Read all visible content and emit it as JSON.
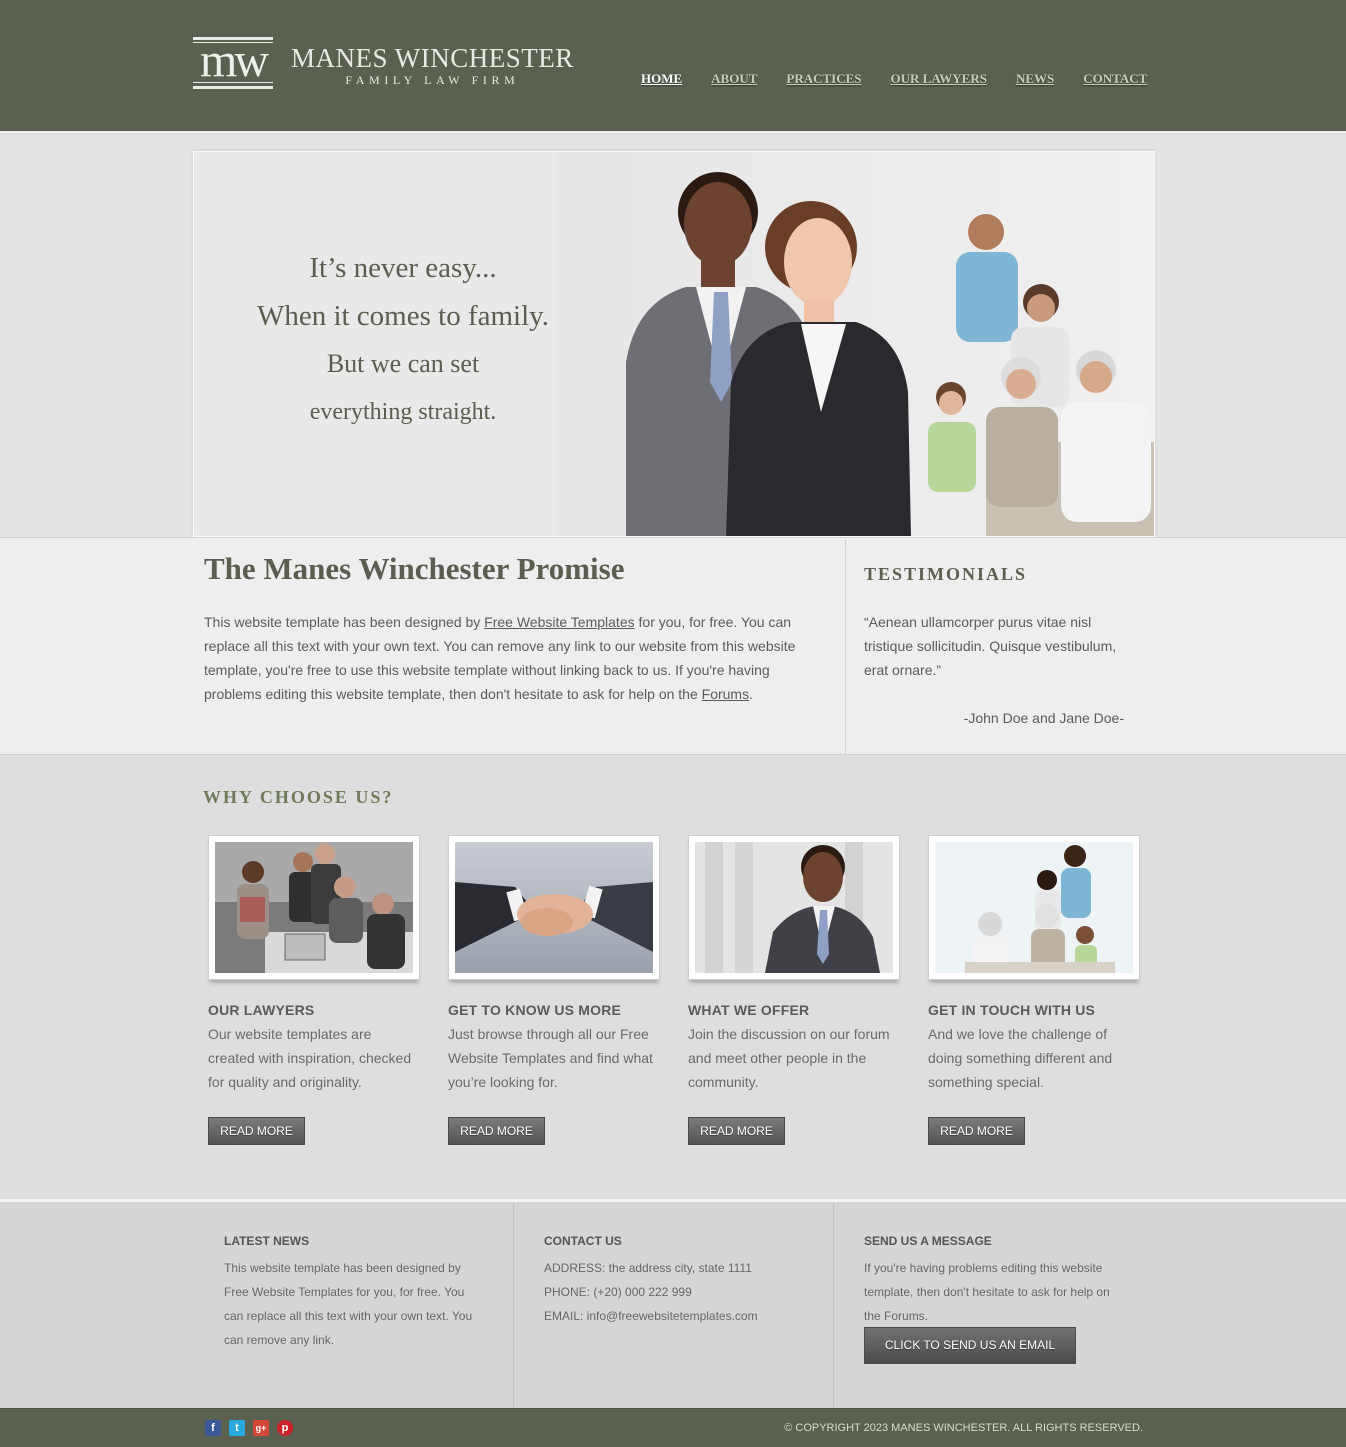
{
  "brand": {
    "logo_mark": "mw",
    "title": "MANES WINCHESTER",
    "subtitle": "FAMILY LAW FIRM"
  },
  "nav": {
    "home": "HOME",
    "about": "ABOUT",
    "practices": "PRACTICES",
    "lawyers": "OUR LAWYERS",
    "news": "NEWS",
    "contact": "CONTACT"
  },
  "hero": {
    "line1": "It’s never easy...",
    "line2": "When it comes to family.",
    "line3": "But we can set",
    "line4": "everything straight."
  },
  "promise": {
    "title": "The Manes Winchester Promise",
    "body_1": "This website template has been designed by ",
    "link_1": "Free Website Templates",
    "body_2": " for you, for free. You can replace all this text with your own text. You can remove any link to our website from this website template, you're free to use this website template without linking back to us. If you're having problems editing this website template, then don't hesitate to ask for help on the ",
    "link_2": "Forums",
    "body_3": "."
  },
  "testimonials": {
    "title": "TESTIMONIALS",
    "quote": "“Aenean ullamcorper purus vitae nisl tristique sollicitudin. Quisque vestibulum, erat ornare.”",
    "author": "-John Doe and Jane Doe-"
  },
  "why": {
    "title": "WHY CHOOSE US?",
    "cards": [
      {
        "heading": "OUR LAWYERS",
        "text": "Our website templates are created with inspiration, checked for quality and originality.",
        "button": "READ MORE"
      },
      {
        "heading": "GET TO KNOW US MORE",
        "text": "Just browse through all our Free Website Templates and find what you’re looking for.",
        "button": "READ MORE"
      },
      {
        "heading": "WHAT WE OFFER",
        "text": "Join the discussion on our forum and meet other people in the community.",
        "button": "READ MORE"
      },
      {
        "heading": "GET IN TOUCH WITH US",
        "text": "And we love the challenge of doing something different and something special.",
        "button": "READ MORE"
      }
    ]
  },
  "footer": {
    "news": {
      "title": "LATEST NEWS",
      "text": "This website template has been designed by Free Website Templates for you, for free. You can replace all this text with your own text. You can remove any link."
    },
    "contact": {
      "title": "CONTACT US",
      "address": "ADDRESS: the address city, state 1111",
      "phone": "PHONE: (+20) 000 222 999",
      "email": "EMAIL: info@freewebsitetemplates.com"
    },
    "message": {
      "title": "SEND US A MESSAGE",
      "text": "If you're having problems editing this website template, then don't hesitate to ask for help on the Forums.",
      "button": "CLICK TO SEND US AN EMAIL"
    }
  },
  "social": {
    "facebook": "f",
    "twitter": "t",
    "googleplus": "g+",
    "pinterest": "p"
  },
  "copyright": "© COPYRIGHT 2023 MANES WINCHESTER. ALL RIGHTS RESERVED.",
  "colors": {
    "header_bg": "#5a6150",
    "accent_text": "#5a5e50",
    "button_bg": "#5e5e5e",
    "page_bg": "#dedede"
  },
  "icons": [
    "facebook-icon",
    "twitter-icon",
    "google-plus-icon",
    "pinterest-icon"
  ]
}
